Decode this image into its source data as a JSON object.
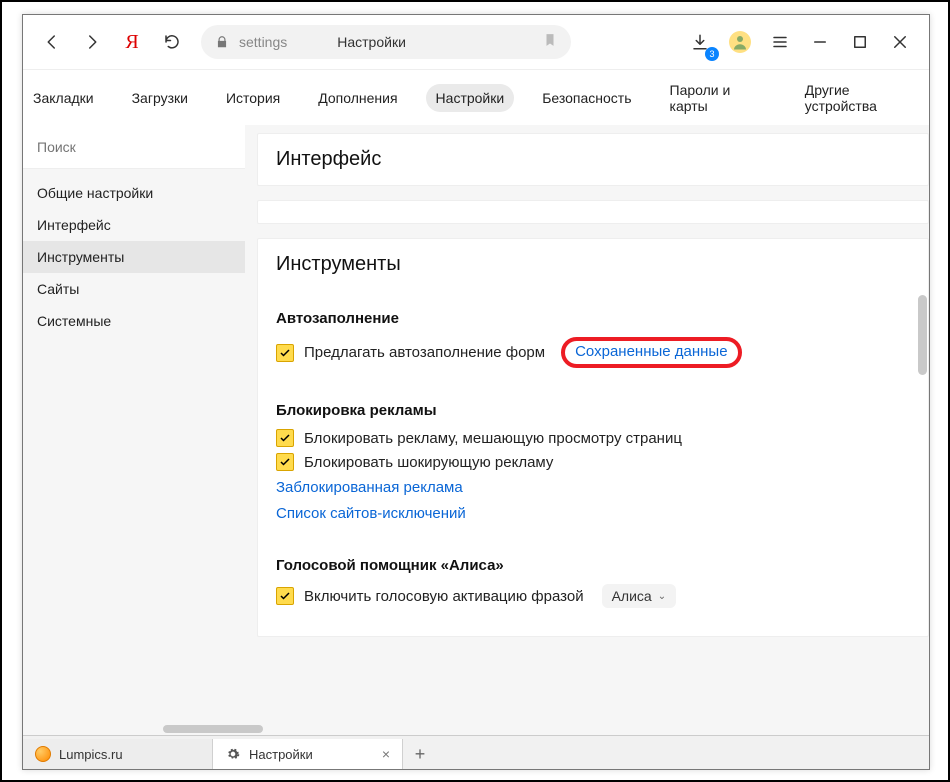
{
  "toolbar": {
    "address_scheme": "settings",
    "address_title": "Настройки",
    "download_badge": "3"
  },
  "topnav": {
    "items": [
      {
        "label": "Закладки"
      },
      {
        "label": "Загрузки"
      },
      {
        "label": "История"
      },
      {
        "label": "Дополнения"
      },
      {
        "label": "Настройки",
        "active": true
      },
      {
        "label": "Безопасность"
      },
      {
        "label": "Пароли и карты"
      },
      {
        "label": "Другие устройства"
      }
    ]
  },
  "sidebar": {
    "search_placeholder": "Поиск",
    "items": [
      {
        "label": "Общие настройки"
      },
      {
        "label": "Интерфейс"
      },
      {
        "label": "Инструменты",
        "active": true
      },
      {
        "label": "Сайты"
      },
      {
        "label": "Системные"
      }
    ]
  },
  "sections": {
    "interface_title": "Интерфейс",
    "tools_title": "Инструменты",
    "autofill": {
      "heading": "Автозаполнение",
      "suggest_label": "Предлагать автозаполнение форм",
      "saved_data_link": "Сохраненные данные"
    },
    "adblock": {
      "heading": "Блокировка рекламы",
      "block_annoying": "Блокировать рекламу, мешающую просмотру страниц",
      "block_shocking": "Блокировать шокирующую рекламу",
      "blocked_link": "Заблокированная реклама",
      "exceptions_link": "Список сайтов-исключений"
    },
    "alice": {
      "heading": "Голосовой помощник «Алиса»",
      "enable_label": "Включить голосовую активацию фразой",
      "dropdown_value": "Алиса"
    }
  },
  "tabs": {
    "items": [
      {
        "label": "Lumpics.ru"
      },
      {
        "label": "Настройки",
        "active": true
      }
    ]
  }
}
